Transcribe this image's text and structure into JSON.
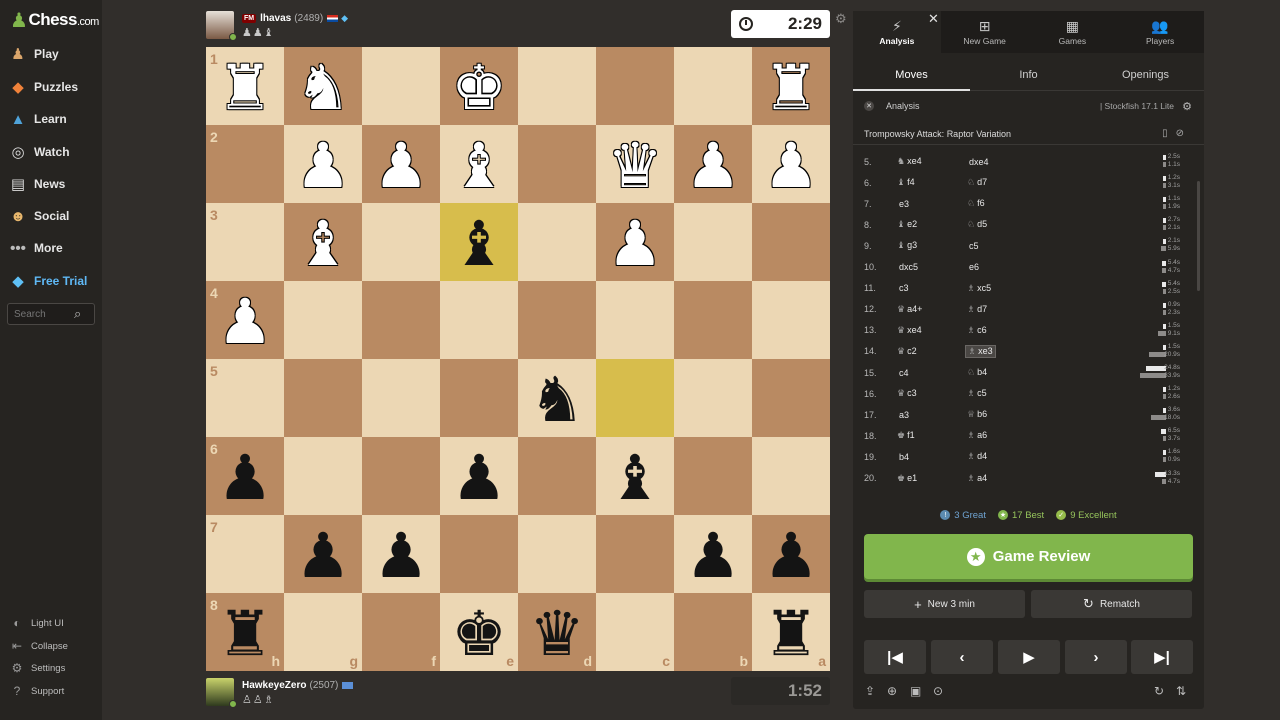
{
  "sidebar": {
    "logo": {
      "brand": "Chess",
      "suffix": ".com"
    },
    "items": [
      {
        "label": "Play",
        "icon": "play-icon"
      },
      {
        "label": "Puzzles",
        "icon": "puzzle-icon"
      },
      {
        "label": "Learn",
        "icon": "learn-icon"
      },
      {
        "label": "Watch",
        "icon": "binoculars-icon"
      },
      {
        "label": "News",
        "icon": "news-icon"
      },
      {
        "label": "Social",
        "icon": "social-icon"
      },
      {
        "label": "More",
        "icon": "more-icon"
      },
      {
        "label": "Free Trial",
        "icon": "diamond-icon"
      }
    ],
    "search_placeholder": "Search",
    "footer": [
      {
        "label": "Light UI",
        "icon": "light-ui-icon"
      },
      {
        "label": "Collapse",
        "icon": "collapse-icon"
      },
      {
        "label": "Settings",
        "icon": "gear-icon"
      },
      {
        "label": "Support",
        "icon": "support-icon"
      }
    ]
  },
  "top_player": {
    "title": "FM",
    "name": "lhavas",
    "rating": "(2489)",
    "captured": "♟♟♝",
    "clock": "2:29"
  },
  "bottom_player": {
    "name": "HawkeyeZero",
    "rating": "(2507)",
    "captured": "♙♙♗",
    "clock": "1:52"
  },
  "board": {
    "ranks": [
      "1",
      "2",
      "3",
      "4",
      "5",
      "6",
      "7",
      "8"
    ],
    "files": [
      "h",
      "g",
      "f",
      "e",
      "d",
      "c",
      "b",
      "a"
    ],
    "rows": [
      [
        "wR",
        "wN",
        "",
        "wK",
        "",
        "",
        "",
        "wR"
      ],
      [
        "",
        "wP",
        "wP",
        "wB",
        "",
        "wQ",
        "wP",
        "wP"
      ],
      [
        "",
        "wB",
        "",
        "bB",
        "",
        "wP",
        "",
        ""
      ],
      [
        "wP",
        "",
        "",
        "",
        "",
        "",
        "",
        ""
      ],
      [
        "",
        "",
        "",
        "",
        "bN",
        "",
        "",
        ""
      ],
      [
        "bP",
        "",
        "",
        "bP",
        "",
        "bB",
        "",
        ""
      ],
      [
        "",
        "bP",
        "bP",
        "",
        "",
        "",
        "bP",
        "bP"
      ],
      [
        "bR",
        "",
        "",
        "bK",
        "bQ",
        "",
        "",
        "bR"
      ]
    ],
    "highlights": [
      "2,3",
      "4,5"
    ]
  },
  "panel": {
    "tabs": [
      {
        "label": "Analysis",
        "icon": "analysis-icon"
      },
      {
        "label": "New Game",
        "icon": "plus-square-icon"
      },
      {
        "label": "Games",
        "icon": "games-icon"
      },
      {
        "label": "Players",
        "icon": "players-icon"
      }
    ],
    "subtabs": [
      "Moves",
      "Info",
      "Openings"
    ],
    "analysis_label": "Analysis",
    "engine": "| Stockfish 17.1 Lite",
    "opening": "Trompowsky Attack: Raptor Variation",
    "moves": [
      {
        "n": "5.",
        "w": "xe4",
        "wp": "♞",
        "b": "dxe4",
        "bp": "",
        "wt": "2.5s",
        "bt": "1.1s",
        "wf": 0.09,
        "bf": 0.04
      },
      {
        "n": "6.",
        "w": "f4",
        "wp": "♝",
        "b": "d7",
        "bp": "♘",
        "wt": "1.2s",
        "bt": "3.1s",
        "wf": 0.05,
        "bf": 0.1
      },
      {
        "n": "7.",
        "w": "e3",
        "wp": "",
        "b": "f6",
        "bp": "♘",
        "wt": "1.1s",
        "bt": "1.9s",
        "wf": 0.04,
        "bf": 0.07
      },
      {
        "n": "8.",
        "w": "e2",
        "wp": "♝",
        "b": "d5",
        "bp": "♘",
        "wt": "2.7s",
        "bt": "2.1s",
        "wf": 0.09,
        "bf": 0.07
      },
      {
        "n": "9.",
        "w": "g3",
        "wp": "♝",
        "b": "c5",
        "bp": "",
        "wt": "2.1s",
        "bt": "5.9s",
        "wf": 0.07,
        "bf": 0.19
      },
      {
        "n": "10.",
        "w": "dxc5",
        "wp": "",
        "b": "e6",
        "bp": "",
        "wt": "5.4s",
        "bt": "4.7s",
        "wf": 0.17,
        "bf": 0.15
      },
      {
        "n": "11.",
        "w": "c3",
        "wp": "",
        "b": "xc5",
        "bp": "♗",
        "wt": "5.4s",
        "bt": "2.5s",
        "wf": 0.17,
        "bf": 0.08
      },
      {
        "n": "12.",
        "w": "a4+",
        "wp": "♛",
        "b": "d7",
        "bp": "♗",
        "wt": "0.9s",
        "bt": "2.3s",
        "wf": 0.03,
        "bf": 0.07
      },
      {
        "n": "13.",
        "w": "xe4",
        "wp": "♛",
        "b": "c6",
        "bp": "♗",
        "wt": "1.5s",
        "bt": "9.1s",
        "wf": 0.05,
        "bf": 0.29
      },
      {
        "n": "14.",
        "w": "c2",
        "wp": "♛",
        "b": "xe3",
        "bp": "♗",
        "wt": "1.5s",
        "bt": "20.9s",
        "wf": 0.05,
        "bf": 0.66,
        "sel": true
      },
      {
        "n": "15.",
        "w": "c4",
        "wp": "",
        "b": "b4",
        "bp": "♘",
        "wt": "24.8s",
        "bt": "33.9s",
        "wf": 0.78,
        "bf": 1.0
      },
      {
        "n": "16.",
        "w": "c3",
        "wp": "♛",
        "b": "c5",
        "bp": "♗",
        "wt": "1.2s",
        "bt": "2.6s",
        "wf": 0.04,
        "bf": 0.08
      },
      {
        "n": "17.",
        "w": "a3",
        "wp": "",
        "b": "b6",
        "bp": "♕",
        "wt": "3.6s",
        "bt": "18.0s",
        "wf": 0.11,
        "bf": 0.56
      },
      {
        "n": "18.",
        "w": "f1",
        "wp": "♚",
        "b": "a6",
        "bp": "♗",
        "wt": "6.5s",
        "bt": "3.7s",
        "wf": 0.2,
        "bf": 0.12
      },
      {
        "n": "19.",
        "w": "b4",
        "wp": "",
        "b": "d4",
        "bp": "♗",
        "wt": "1.6s",
        "bt": "0.9s",
        "wf": 0.05,
        "bf": 0.03
      },
      {
        "n": "20.",
        "w": "e1",
        "wp": "♚",
        "b": "a4",
        "bp": "♗",
        "wt": "13.3s",
        "bt": "4.7s",
        "wf": 0.42,
        "bf": 0.15
      }
    ],
    "stats": [
      {
        "label": "3 Great",
        "color": "#5c8bb0",
        "icon": "!"
      },
      {
        "label": "17 Best",
        "color": "#81b64c",
        "icon": "★"
      },
      {
        "label": "9 Excellent",
        "color": "#96bc4b",
        "icon": "👍"
      }
    ],
    "review_label": "Game Review",
    "new_game_label": "New 3 min",
    "rematch_label": "Rematch",
    "nav": [
      "⏮",
      "◀",
      "▶",
      "▶",
      "⏭"
    ]
  },
  "colors": {
    "light": "#ecd7b4",
    "dark": "#b98a62",
    "accent": "#81b64c"
  }
}
